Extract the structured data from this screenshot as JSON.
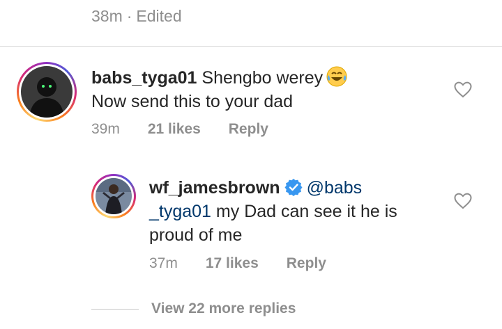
{
  "top_meta": {
    "time": "38m",
    "separator": "·",
    "edited": "Edited"
  },
  "comment1": {
    "username": "babs_tyga01",
    "text_line1": "Shengbo werey",
    "emoji": "face-with-tears-of-joy",
    "text_line2": "Now send this to your dad",
    "time": "39m",
    "likes": "21 likes",
    "reply_label": "Reply"
  },
  "reply1": {
    "username": "wf_jamesbrown",
    "verified": true,
    "mention_part1": "@babs",
    "mention_part2": "_tyga01",
    "text_line2_rest": "my Dad can see it he is",
    "text_line3": "proud of me",
    "time": "37m",
    "likes": "17 likes",
    "reply_label": "Reply"
  },
  "view_more": {
    "label": "View 22 more replies"
  },
  "colors": {
    "text": "#262626",
    "secondary": "#8e8e8e",
    "mention": "#00376b",
    "verified": "#3897f0"
  }
}
